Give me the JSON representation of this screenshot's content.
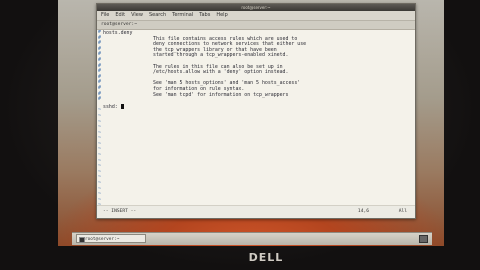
{
  "window": {
    "title": "root@server:~",
    "menu": [
      "File",
      "Edit",
      "View",
      "Search",
      "Terminal",
      "Tabs",
      "Help"
    ],
    "tab_label": "root@server:~"
  },
  "editor": {
    "lines": [
      {
        "text": "hosts.deny",
        "indent": false
      },
      {
        "text": "This file contains access rules which are used to",
        "indent": true
      },
      {
        "text": "deny connections to network services that either use",
        "indent": true
      },
      {
        "text": "the tcp_wrappers library or that have been",
        "indent": true
      },
      {
        "text": "started through a tcp_wrappers-enabled xinetd.",
        "indent": true
      },
      {
        "text": "",
        "indent": false
      },
      {
        "text": "The rules in this file can also be set up in",
        "indent": true
      },
      {
        "text": "/etc/hosts.allow with a 'deny' option instead.",
        "indent": true
      },
      {
        "text": "",
        "indent": false
      },
      {
        "text": "See 'man 5 hosts_options' and 'man 5 hosts_access'",
        "indent": true
      },
      {
        "text": "for information on rule syntax.",
        "indent": true
      },
      {
        "text": "See 'man tcpd' for information on tcp_wrappers",
        "indent": true
      },
      {
        "text": "",
        "indent": false
      },
      {
        "text": "sshd: ",
        "indent": false
      }
    ],
    "gutter": [
      "#",
      "#",
      "#",
      "#",
      "#",
      "#",
      "#",
      "#",
      "#",
      "#",
      "#",
      "#",
      "#",
      "",
      "~",
      "~",
      "~",
      "~",
      "~",
      "~",
      "~",
      "~",
      "~",
      "~",
      "~",
      "~",
      "~",
      "~",
      "~",
      "~",
      "~",
      "~",
      "~"
    ]
  },
  "status": {
    "mode": "-- INSERT --",
    "position": "14,6",
    "percent": "All"
  },
  "taskbar": {
    "task_label": "root@server:~"
  },
  "brand": {
    "logo": "DELL"
  }
}
